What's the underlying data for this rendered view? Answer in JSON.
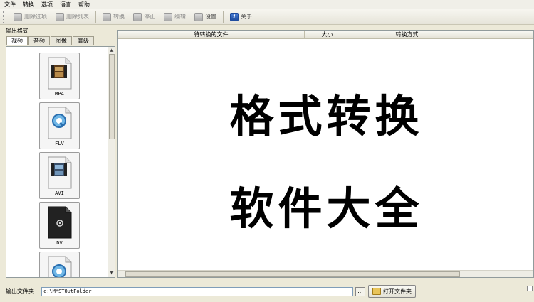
{
  "menu": [
    "文件",
    "转换",
    "选项",
    "语言",
    "帮助"
  ],
  "toolbar": {
    "delete_option": "删除选项",
    "delete_list": "删除列表",
    "convert": "转换",
    "stop": "停止",
    "edit": "编辑",
    "settings": "设置",
    "about": "关于"
  },
  "left": {
    "title": "输出格式",
    "tabs": [
      "视频",
      "音频",
      "图像",
      "高级"
    ],
    "formats": [
      {
        "label": "MP4",
        "badge": ".MP4",
        "icon": "mp4-file-icon"
      },
      {
        "label": "FLV",
        "badge": "FLV",
        "icon": "flv-file-icon"
      },
      {
        "label": "AVI",
        "badge": ".AVI",
        "icon": "avi-file-icon"
      },
      {
        "label": "DV",
        "badge": "DV",
        "icon": "dv-file-icon"
      },
      {
        "label": "",
        "badge": "",
        "icon": "quicktime-file-icon"
      }
    ]
  },
  "table": {
    "columns": [
      "待转换的文件",
      "大小",
      "转换方式"
    ]
  },
  "overlay": {
    "line1": "格式转换",
    "line2": "软件大全"
  },
  "bottom": {
    "output_label": "输出文件夹",
    "output_path": "c:\\MMSTOutFolder",
    "browse": "...",
    "open_folder": "打开文件夹"
  }
}
